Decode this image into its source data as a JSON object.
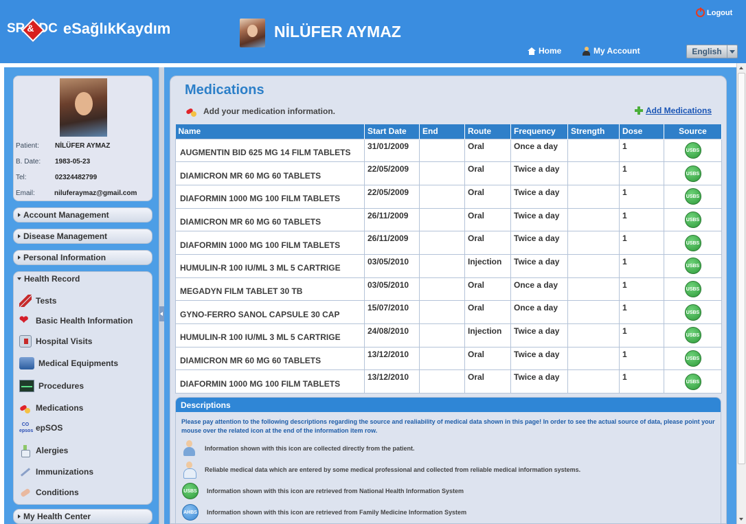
{
  "header": {
    "logo_left": "SR",
    "logo_amp": "&",
    "logo_right": "DC",
    "app_title": "eSağlıkKaydım",
    "user_name": "NİLÜFER AYMAZ",
    "logout": "Logout",
    "home": "Home",
    "my_account": "My Account",
    "language": "English"
  },
  "profile": {
    "patient_label": "Patient:",
    "patient": "NİLÜFER AYMAZ",
    "bdate_label": "B. Date:",
    "bdate": "1983-05-23",
    "tel_label": "Tel:",
    "tel": "02324482799",
    "email_label": "Email:",
    "email": "niluferaymaz@gmail.com"
  },
  "sidebar": {
    "account_management": "Account Management",
    "disease_management": "Disease Management",
    "personal_information": "Personal Information",
    "health_record": "Health Record",
    "my_health_center": "My Health Center",
    "health_items": [
      {
        "label": "Tests",
        "icon": "tests-icon"
      },
      {
        "label": "Basic Health Information",
        "icon": "heart-icon"
      },
      {
        "label": "Hospital Visits",
        "icon": "hospital-icon"
      },
      {
        "label": "Medical Equipments",
        "icon": "equipment-icon"
      },
      {
        "label": "Procedures",
        "icon": "procedures-icon"
      },
      {
        "label": "Medications",
        "icon": "medications-icon"
      },
      {
        "label": "epSOS",
        "icon": "epsos-icon"
      },
      {
        "label": "Alergies",
        "icon": "allergies-icon"
      },
      {
        "label": "Immunizations",
        "icon": "immunizations-icon"
      },
      {
        "label": "Conditions",
        "icon": "conditions-icon"
      }
    ]
  },
  "main": {
    "title": "Medications",
    "subtitle": "Add your medication information.",
    "add_link": "Add Medications",
    "columns": [
      "Name",
      "Start Date",
      "End",
      "Route",
      "Frequency",
      "Strength",
      "Dose",
      "Source"
    ],
    "rows": [
      {
        "name": "AUGMENTIN BID 625 MG 14 FILM TABLETS",
        "start": "31/01/2009",
        "end": "",
        "route": "Oral",
        "frequency": "Once a day",
        "strength": "",
        "dose": "1",
        "source": "USBS"
      },
      {
        "name": "DIAMICRON MR 60 MG 60 TABLETS",
        "start": "22/05/2009",
        "end": "",
        "route": "Oral",
        "frequency": "Twice a day",
        "strength": "",
        "dose": "1",
        "source": "USBS"
      },
      {
        "name": "DIAFORMIN 1000 MG 100 FILM TABLETS",
        "start": "22/05/2009",
        "end": "",
        "route": "Oral",
        "frequency": "Twice a day",
        "strength": "",
        "dose": "1",
        "source": "USBS"
      },
      {
        "name": "DIAMICRON MR 60 MG 60 TABLETS",
        "start": "26/11/2009",
        "end": "",
        "route": "Oral",
        "frequency": "Twice a day",
        "strength": "",
        "dose": "1",
        "source": "USBS"
      },
      {
        "name": "DIAFORMIN 1000 MG 100 FILM TABLETS",
        "start": "26/11/2009",
        "end": "",
        "route": "Oral",
        "frequency": "Twice a day",
        "strength": "",
        "dose": "1",
        "source": "USBS"
      },
      {
        "name": "HUMULIN-R 100 IU/ML 3 ML 5 CARTRIGE",
        "start": "03/05/2010",
        "end": "",
        "route": "Injection",
        "frequency": "Twice a day",
        "strength": "",
        "dose": "1",
        "source": "USBS"
      },
      {
        "name": "MEGADYN FILM TABLET 30 TB",
        "start": "03/05/2010",
        "end": "",
        "route": "Oral",
        "frequency": "Once a day",
        "strength": "",
        "dose": "1",
        "source": "USBS"
      },
      {
        "name": "GYNO-FERRO SANOL CAPSULE 30 CAP",
        "start": "15/07/2010",
        "end": "",
        "route": "Oral",
        "frequency": "Once a day",
        "strength": "",
        "dose": "1",
        "source": "USBS"
      },
      {
        "name": "HUMULIN-R 100 IU/ML 3 ML 5 CARTRIGE",
        "start": "24/08/2010",
        "end": "",
        "route": "Injection",
        "frequency": "Twice a day",
        "strength": "",
        "dose": "1",
        "source": "USBS"
      },
      {
        "name": "DIAMICRON MR 60 MG 60 TABLETS",
        "start": "13/12/2010",
        "end": "",
        "route": "Oral",
        "frequency": "Twice a day",
        "strength": "",
        "dose": "1",
        "source": "USBS"
      },
      {
        "name": "DIAFORMIN 1000 MG 100 FILM TABLETS",
        "start": "13/12/2010",
        "end": "",
        "route": "Oral",
        "frequency": "Twice a day",
        "strength": "",
        "dose": "1",
        "source": "USBS"
      }
    ]
  },
  "descriptions": {
    "title": "Descriptions",
    "intro": "Please pay attention to the following descriptions regarding the source and realiability of medical data shown in this page! In order to see the actual source of data, please point your mouse over the related icon at the end of the information item row.",
    "items": [
      {
        "text": "Information shown with this icon are collected directly from the patient.",
        "icon": "patient-icon"
      },
      {
        "text": "Reliable medical data which are entered by some medical professional and collected from reliable medical information systems.",
        "icon": "doctor-icon"
      },
      {
        "text": "Information shown with this icon are retrieved from National Health Information System",
        "icon": "usbs-icon",
        "badge": "USBS"
      },
      {
        "text": "Information shown with this icon are retrieved from Family Medicine Information System",
        "icon": "ahbs-icon",
        "badge": "AHBS"
      }
    ]
  },
  "colors": {
    "header_blue": "#3a8de0",
    "table_header": "#2f7fc9",
    "title_blue": "#2c7fc8",
    "usbs_green": "#2e9a3a"
  }
}
